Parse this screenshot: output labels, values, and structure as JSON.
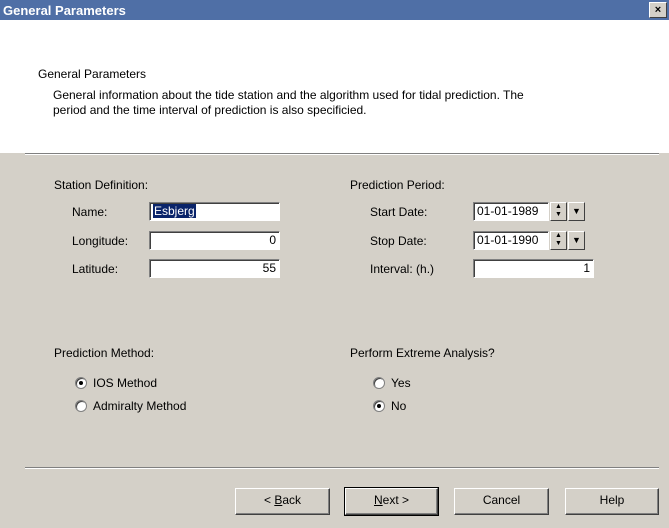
{
  "window": {
    "title": "General Parameters",
    "close_label": "×"
  },
  "header": {
    "heading": "General Parameters",
    "description_line1": "General information about the tide station and the algorithm used for tidal prediction. The",
    "description_line2": "period and the time interval of prediction is also specificied."
  },
  "station": {
    "group_label": "Station Definition:",
    "name_label": "Name:",
    "name_value": "Esbjerg",
    "longitude_label": "Longitude:",
    "longitude_value": "0",
    "latitude_label": "Latitude:",
    "latitude_value": "55"
  },
  "period": {
    "group_label": "Prediction Period:",
    "start_label": "Start Date:",
    "start_value": "01-01-1989",
    "stop_label": "Stop Date:",
    "stop_value": "01-01-1990",
    "interval_label": "Interval: (h.)",
    "interval_value": "1"
  },
  "method": {
    "group_label": "Prediction Method:",
    "options": [
      {
        "label": "IOS Method",
        "selected": true
      },
      {
        "label": "Admiralty Method",
        "selected": false
      }
    ]
  },
  "extreme": {
    "group_label": "Perform Extreme Analysis?",
    "options": [
      {
        "label": "Yes",
        "selected": false
      },
      {
        "label": "No",
        "selected": true
      }
    ]
  },
  "buttons": {
    "back_prefix": "< ",
    "back_mnemonic": "B",
    "back_rest": "ack",
    "next_mnemonic": "N",
    "next_rest": "ext >",
    "cancel": "Cancel",
    "help": "Help"
  },
  "colors": {
    "titlebar": "#4f6fa6",
    "face": "#d4d0c8",
    "selection": "#0a246a"
  }
}
